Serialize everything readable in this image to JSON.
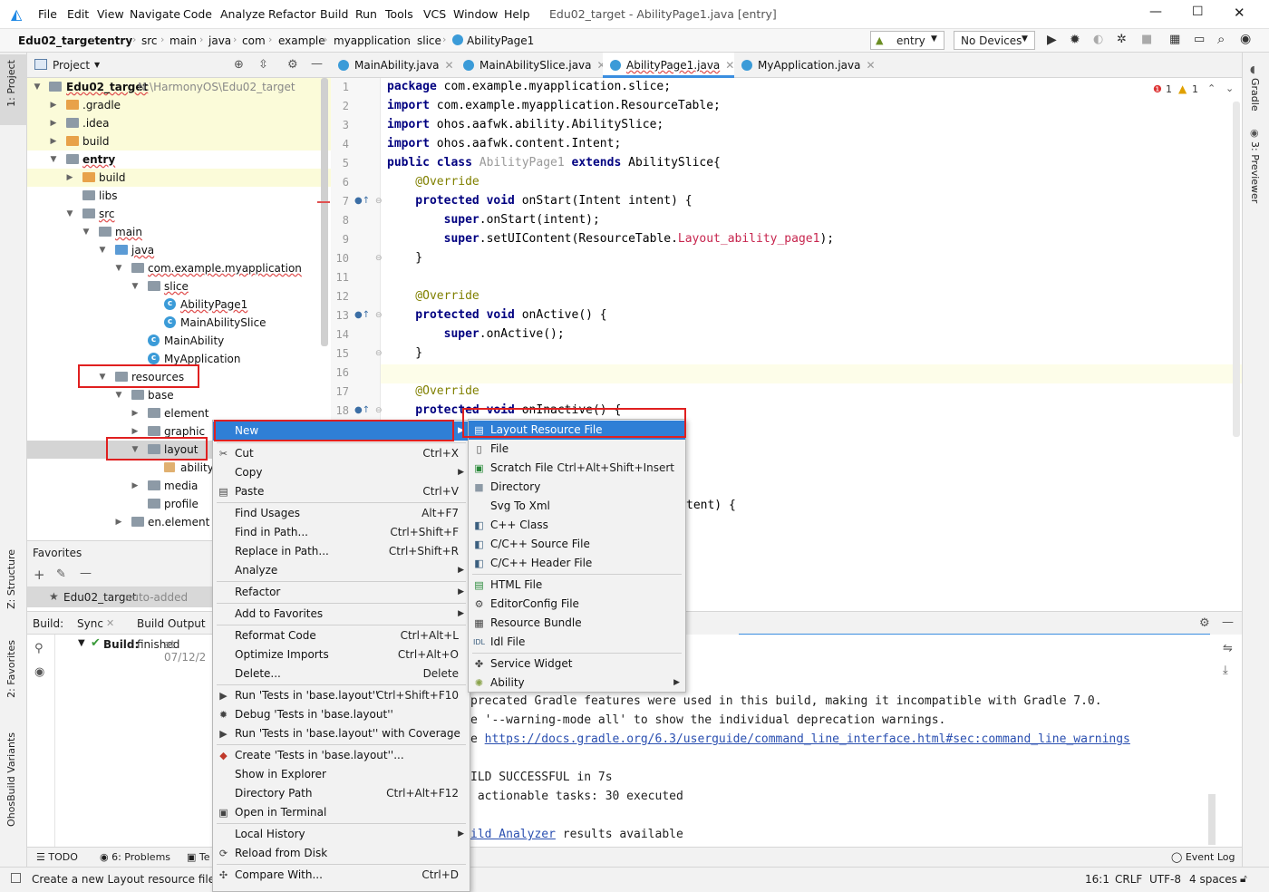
{
  "titlebar": {
    "menus": [
      "File",
      "Edit",
      "View",
      "Navigate",
      "Code",
      "Analyze",
      "Refactor",
      "Build",
      "Run",
      "Tools",
      "VCS",
      "Window",
      "Help"
    ],
    "title": "Edu02_target - AbilityPage1.java [entry]"
  },
  "breadcrumb": [
    "Edu02_target",
    "entry",
    "src",
    "main",
    "java",
    "com",
    "example",
    "myapplication",
    "slice",
    "AbilityPage1"
  ],
  "run_config": "entry",
  "device": "No Devices",
  "left_strip": {
    "project": "1: Project",
    "structure": "Z: Structure",
    "favorites": "2: Favorites",
    "variants": "OhosBuild Variants"
  },
  "right_strip": {
    "gradle": "Gradle",
    "previewer": "3: Previewer"
  },
  "project_panel": {
    "title": "Project"
  },
  "tree": [
    {
      "label": "Edu02_target",
      "extra": "N:\\HarmonyOS\\Edu02_target",
      "bold": true
    },
    {
      "label": ".gradle"
    },
    {
      "label": ".idea"
    },
    {
      "label": "build"
    },
    {
      "label": "entry",
      "bold": true
    },
    {
      "label": "build"
    },
    {
      "label": "libs"
    },
    {
      "label": "src"
    },
    {
      "label": "main"
    },
    {
      "label": "java"
    },
    {
      "label": "com.example.myapplication"
    },
    {
      "label": "slice"
    },
    {
      "label": "AbilityPage1"
    },
    {
      "label": "MainAbilitySlice"
    },
    {
      "label": "MainAbility"
    },
    {
      "label": "MyApplication"
    },
    {
      "label": "resources"
    },
    {
      "label": "base"
    },
    {
      "label": "element"
    },
    {
      "label": "graphic"
    },
    {
      "label": "layout"
    },
    {
      "label": "ability_"
    },
    {
      "label": "media"
    },
    {
      "label": "profile"
    },
    {
      "label": "en.element"
    }
  ],
  "favorites": {
    "title": "Favorites",
    "item": "Edu02_target",
    "item_note": "auto-added"
  },
  "build_panel": {
    "label": "Build:",
    "tabs": [
      "Sync",
      "Build Output"
    ],
    "status_bold": "Build:",
    "status": "finished",
    "status_time": "at 07/12/2"
  },
  "editor_tabs": [
    "MainAbility.java",
    "MainAbilitySlice.java",
    "AbilityPage1.java",
    "MyApplication.java"
  ],
  "inspections": {
    "errors": "1",
    "warnings": "1"
  },
  "line_numbers": [
    "1",
    "2",
    "3",
    "4",
    "5",
    "6",
    "7",
    "8",
    "9",
    "10",
    "11",
    "12",
    "13",
    "14",
    "15",
    "16",
    "17",
    "18"
  ],
  "code": {
    "l1_kw": "package",
    "l1": " com.example.myapplication.slice;",
    "l2_kw": "import",
    "l2": " com.example.myapplication.ResourceTable;",
    "l3_kw": "import",
    "l3": " ohos.aafwk.ability.AbilitySlice;",
    "l4_kw": "import",
    "l4": " ohos.aafwk.content.Intent;",
    "l5_kw1": "public class",
    "l5_name": " AbilityPage1 ",
    "l5_kw2": "extends",
    "l5": " AbilitySlice{",
    "l6": "    @Override",
    "l7_kw": "    protected void",
    "l7": " onStart(Intent intent) {",
    "l8_kw": "        super",
    "l8": ".onStart(intent);",
    "l9_kw": "        super",
    "l9a": ".setUIContent(ResourceTable.",
    "l9_ref": "Layout_ability_page1",
    "l9b": ");",
    "l10": "    }",
    "l12": "    @Override",
    "l13_kw": "    protected void",
    "l13": " onActive() {",
    "l14_kw": "        super",
    "l14": ".onActive();",
    "l15": "    }",
    "l17": "    @Override",
    "l18_kw": "    protected void",
    "l18": " onInactive() {",
    "l_right": "tent) {"
  },
  "console": [
    "precated Gradle features were used in this build, making it incompatible with Gradle 7.0.",
    "e '--warning-mode all' to show the individual deprecation warnings.",
    "e ",
    "ILD SUCCESSFUL in 7s",
    " actionable tasks: 30 executed",
    "ild Analyzer",
    " results available"
  ],
  "console_link": "https://docs.gradle.org/6.3/userguide/command_line_interface.html#sec:command_line_warnings",
  "context_menu": [
    {
      "label": "New",
      "sub": true,
      "selected": true
    },
    {
      "label": "Cut",
      "shortcut": "Ctrl+X",
      "icon": "✂"
    },
    {
      "label": "Copy",
      "sub": true
    },
    {
      "label": "Paste",
      "shortcut": "Ctrl+V",
      "icon": "▤"
    },
    {
      "label": "Find Usages",
      "shortcut": "Alt+F7"
    },
    {
      "label": "Find in Path...",
      "shortcut": "Ctrl+Shift+F"
    },
    {
      "label": "Replace in Path...",
      "shortcut": "Ctrl+Shift+R"
    },
    {
      "label": "Analyze",
      "sub": true
    },
    {
      "label": "Refactor",
      "sub": true
    },
    {
      "label": "Add to Favorites",
      "sub": true
    },
    {
      "label": "Reformat Code",
      "shortcut": "Ctrl+Alt+L"
    },
    {
      "label": "Optimize Imports",
      "shortcut": "Ctrl+Alt+O"
    },
    {
      "label": "Delete...",
      "shortcut": "Delete"
    },
    {
      "label": "Run 'Tests in 'base.layout''",
      "shortcut": "Ctrl+Shift+F10",
      "icon": "▶"
    },
    {
      "label": "Debug 'Tests in 'base.layout''",
      "icon": "✹"
    },
    {
      "label": "Run 'Tests in 'base.layout'' with Coverage",
      "icon": "▶"
    },
    {
      "label": "Create 'Tests in 'base.layout''...",
      "icon": "◆"
    },
    {
      "label": "Show in Explorer"
    },
    {
      "label": "Directory Path",
      "shortcut": "Ctrl+Alt+F12"
    },
    {
      "label": "Open in Terminal",
      "icon": "▣"
    },
    {
      "label": "Local History",
      "sub": true
    },
    {
      "label": "Reload from Disk",
      "icon": "⟳"
    },
    {
      "label": "Compare With...",
      "shortcut": "Ctrl+D",
      "icon": "✣"
    }
  ],
  "new_submenu": [
    {
      "label": "Layout Resource File",
      "selected": true
    },
    {
      "label": "File"
    },
    {
      "label": "Scratch File",
      "shortcut": "Ctrl+Alt+Shift+Insert"
    },
    {
      "label": "Directory"
    },
    {
      "label": "Svg To Xml"
    },
    {
      "label": "C++ Class"
    },
    {
      "label": "C/C++ Source File"
    },
    {
      "label": "C/C++ Header File"
    },
    {
      "label": "HTML File"
    },
    {
      "label": "EditorConfig File"
    },
    {
      "label": "Resource Bundle"
    },
    {
      "label": "Idl File"
    },
    {
      "label": "Service Widget"
    },
    {
      "label": "Ability",
      "sub": true
    }
  ],
  "bottom_tools": {
    "todo": "TODO",
    "problems": "6: Problems",
    "te": "Te",
    "event_log": "Event Log"
  },
  "status": {
    "message": "Create a new Layout resource file",
    "position": "16:1",
    "line_sep": "CRLF",
    "encoding": "UTF-8",
    "indent": "4 spaces"
  }
}
